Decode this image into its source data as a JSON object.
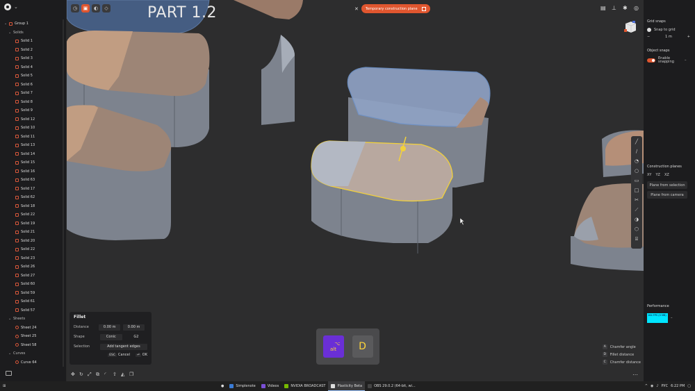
{
  "sidebar": {
    "tree": [
      {
        "label": "Group 1",
        "level": 0,
        "type": "group",
        "twisty": "v"
      },
      {
        "label": "Solids",
        "level": 1,
        "type": "header",
        "twisty": "v"
      },
      {
        "label": "Solid 1",
        "level": 2,
        "type": "solid"
      },
      {
        "label": "Solid 2",
        "level": 2,
        "type": "solid"
      },
      {
        "label": "Solid 3",
        "level": 2,
        "type": "solid"
      },
      {
        "label": "Solid 4",
        "level": 2,
        "type": "solid"
      },
      {
        "label": "Solid 5",
        "level": 2,
        "type": "solid"
      },
      {
        "label": "Solid 6",
        "level": 2,
        "type": "solid"
      },
      {
        "label": "Solid 7",
        "level": 2,
        "type": "solid"
      },
      {
        "label": "Solid 8",
        "level": 2,
        "type": "solid"
      },
      {
        "label": "Solid 9",
        "level": 2,
        "type": "solid"
      },
      {
        "label": "Solid 12",
        "level": 2,
        "type": "solid"
      },
      {
        "label": "Solid 10",
        "level": 2,
        "type": "solid"
      },
      {
        "label": "Solid 11",
        "level": 2,
        "type": "solid"
      },
      {
        "label": "Solid 13",
        "level": 2,
        "type": "solid"
      },
      {
        "label": "Solid 14",
        "level": 2,
        "type": "solid"
      },
      {
        "label": "Solid 15",
        "level": 2,
        "type": "solid"
      },
      {
        "label": "Solid 16",
        "level": 2,
        "type": "solid"
      },
      {
        "label": "Solid 63",
        "level": 2,
        "type": "solid"
      },
      {
        "label": "Solid 17",
        "level": 2,
        "type": "solid"
      },
      {
        "label": "Solid 62",
        "level": 2,
        "type": "solid"
      },
      {
        "label": "Solid 18",
        "level": 2,
        "type": "solid"
      },
      {
        "label": "Solid 22",
        "level": 2,
        "type": "solid"
      },
      {
        "label": "Solid 19",
        "level": 2,
        "type": "solid"
      },
      {
        "label": "Solid 21",
        "level": 2,
        "type": "solid"
      },
      {
        "label": "Solid 20",
        "level": 2,
        "type": "solid"
      },
      {
        "label": "Solid 22",
        "level": 2,
        "type": "solid"
      },
      {
        "label": "Solid 23",
        "level": 2,
        "type": "solid"
      },
      {
        "label": "Solid 26",
        "level": 2,
        "type": "solid"
      },
      {
        "label": "Solid 27",
        "level": 2,
        "type": "solid"
      },
      {
        "label": "Solid 60",
        "level": 2,
        "type": "solid"
      },
      {
        "label": "Solid 59",
        "level": 2,
        "type": "solid"
      },
      {
        "label": "Solid 61",
        "level": 2,
        "type": "solid"
      },
      {
        "label": "Solid 57",
        "level": 2,
        "type": "solid"
      },
      {
        "label": "Sheets",
        "level": 1,
        "type": "header",
        "twisty": "v"
      },
      {
        "label": "Sheet 24",
        "level": 2,
        "type": "sheet"
      },
      {
        "label": "Sheet 25",
        "level": 2,
        "type": "sheet"
      },
      {
        "label": "Sheet 58",
        "level": 2,
        "type": "sheet"
      },
      {
        "label": "Curves",
        "level": 1,
        "type": "header",
        "twisty": "v"
      },
      {
        "label": "Curve 64",
        "level": 2,
        "type": "curve"
      },
      {
        "label": "Curve 65",
        "level": 2,
        "type": "curve"
      },
      {
        "label": "Curve 66",
        "level": 2,
        "type": "curve"
      }
    ]
  },
  "viewport": {
    "part_title": "PART 1.2",
    "temp_plane_label": "Temporary construction plane"
  },
  "fillet": {
    "title": "Fillet",
    "distance_label": "Distance",
    "distance_1": "0.00 m",
    "distance_2": "0.00 m",
    "shape_label": "Shape",
    "shape_value": "Conic",
    "shape_extra": "G2",
    "selection_label": "Selection",
    "selection_value": "Add tangent edges",
    "cancel_key": "ESC",
    "cancel_label": "Cancel",
    "ok_key": "⏎",
    "ok_label": "OK"
  },
  "keys": {
    "alt_symbol": "⌥",
    "alt_label": "alt",
    "d_label": "D"
  },
  "hints": [
    {
      "key": "A",
      "label": "Chamfer angle"
    },
    {
      "key": "D",
      "label": "Fillet distance"
    },
    {
      "key": "C",
      "label": "Chamfer distance"
    }
  ],
  "right_panel": {
    "grid_snaps_title": "Grid snaps",
    "snap_to_grid": "Snap to grid",
    "grid_minus": "−",
    "grid_value": "1 m",
    "grid_plus": "+",
    "object_snaps_title": "Object snaps",
    "enable_snapping": "Enable snapping",
    "construction_planes_title": "Construction planes",
    "plane_xy": "XY",
    "plane_yz": "YZ",
    "plane_xz": "XZ",
    "plane_from_selection": "Plane from selection",
    "plane_from_camera": "Plane from camera",
    "performance_title": "Performance",
    "fps_text": "164 FPS (0 MB)"
  },
  "taskbar": {
    "items": [
      {
        "label": "Simplenote",
        "color": "#3a7bd5",
        "active": false
      },
      {
        "label": "Videos",
        "color": "#7a4fd6",
        "active": false
      },
      {
        "label": "NVIDIA BROADCAST",
        "color": "#76b900",
        "active": false
      },
      {
        "label": "Plasticity Beta",
        "color": "#dddddd",
        "active": true
      },
      {
        "label": "OBS 29.0.2 (64-bit, wi...",
        "color": "#444444",
        "active": false
      }
    ],
    "lang": "РУС",
    "time": "6:22 PM"
  },
  "colors": {
    "accent": "#e0562f",
    "selection_yellow": "#f2d13b",
    "highlight_blue": "#6f93c9",
    "face_tan": "#b9927a"
  }
}
